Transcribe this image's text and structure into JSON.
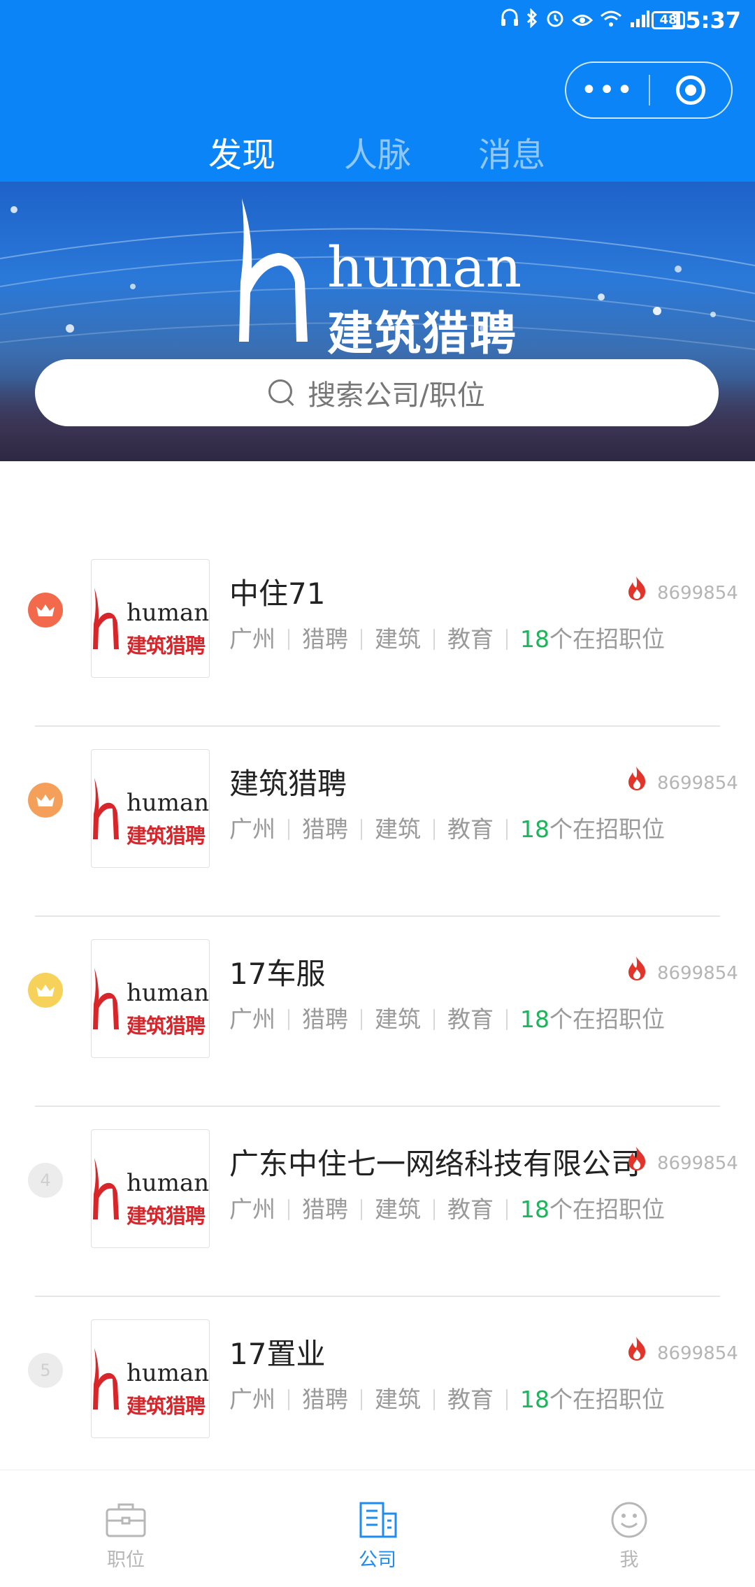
{
  "status_bar": {
    "time": "15:37",
    "battery": "48"
  },
  "capsule": {
    "more_label": "•••"
  },
  "tabs": [
    {
      "label": "发现",
      "active": true
    },
    {
      "label": "人脉",
      "active": false
    },
    {
      "label": "消息",
      "active": false
    }
  ],
  "banner": {
    "logo_word": "human",
    "logo_cn": "建筑猎聘"
  },
  "search": {
    "placeholder": "搜索公司/职位"
  },
  "companies": [
    {
      "rank": "",
      "rank_color": "#f26a4b",
      "name": "中住71",
      "heat": "8699854",
      "tags": [
        "广州",
        "猎聘",
        "建筑",
        "教育"
      ],
      "jobs_count": "18",
      "jobs_suffix": "个在招职位",
      "logo_word": "human",
      "logo_cn": "建筑猎聘"
    },
    {
      "rank": "",
      "rank_color": "#f5a05a",
      "name": "建筑猎聘",
      "heat": "8699854",
      "tags": [
        "广州",
        "猎聘",
        "建筑",
        "教育"
      ],
      "jobs_count": "18",
      "jobs_suffix": "个在招职位",
      "logo_word": "human",
      "logo_cn": "建筑猎聘"
    },
    {
      "rank": "",
      "rank_color": "#f7d25a",
      "name": "17车服",
      "heat": "8699854",
      "tags": [
        "广州",
        "猎聘",
        "建筑",
        "教育"
      ],
      "jobs_count": "18",
      "jobs_suffix": "个在招职位",
      "logo_word": "human",
      "logo_cn": "建筑猎聘"
    },
    {
      "rank": "4",
      "rank_color": "#ececec",
      "name": "广东中住七一网络科技有限公司",
      "heat": "8699854",
      "tags": [
        "广州",
        "猎聘",
        "建筑",
        "教育"
      ],
      "jobs_count": "18",
      "jobs_suffix": "个在招职位",
      "logo_word": "human",
      "logo_cn": "建筑猎聘"
    },
    {
      "rank": "5",
      "rank_color": "#ececec",
      "name": "17置业",
      "heat": "8699854",
      "tags": [
        "广州",
        "猎聘",
        "建筑",
        "教育"
      ],
      "jobs_count": "18",
      "jobs_suffix": "个在招职位",
      "logo_word": "human",
      "logo_cn": "建筑猎聘"
    }
  ],
  "bottom_nav": [
    {
      "label": "职位",
      "icon": "briefcase-icon",
      "active": false
    },
    {
      "label": "公司",
      "icon": "building-icon",
      "active": true
    },
    {
      "label": "我",
      "icon": "smiley-icon",
      "active": false
    }
  ],
  "colors": {
    "primary": "#0a84f6",
    "jobs_count": "#1fb35b",
    "fire": "#e2342a",
    "active_nav": "#1f8cf2"
  }
}
